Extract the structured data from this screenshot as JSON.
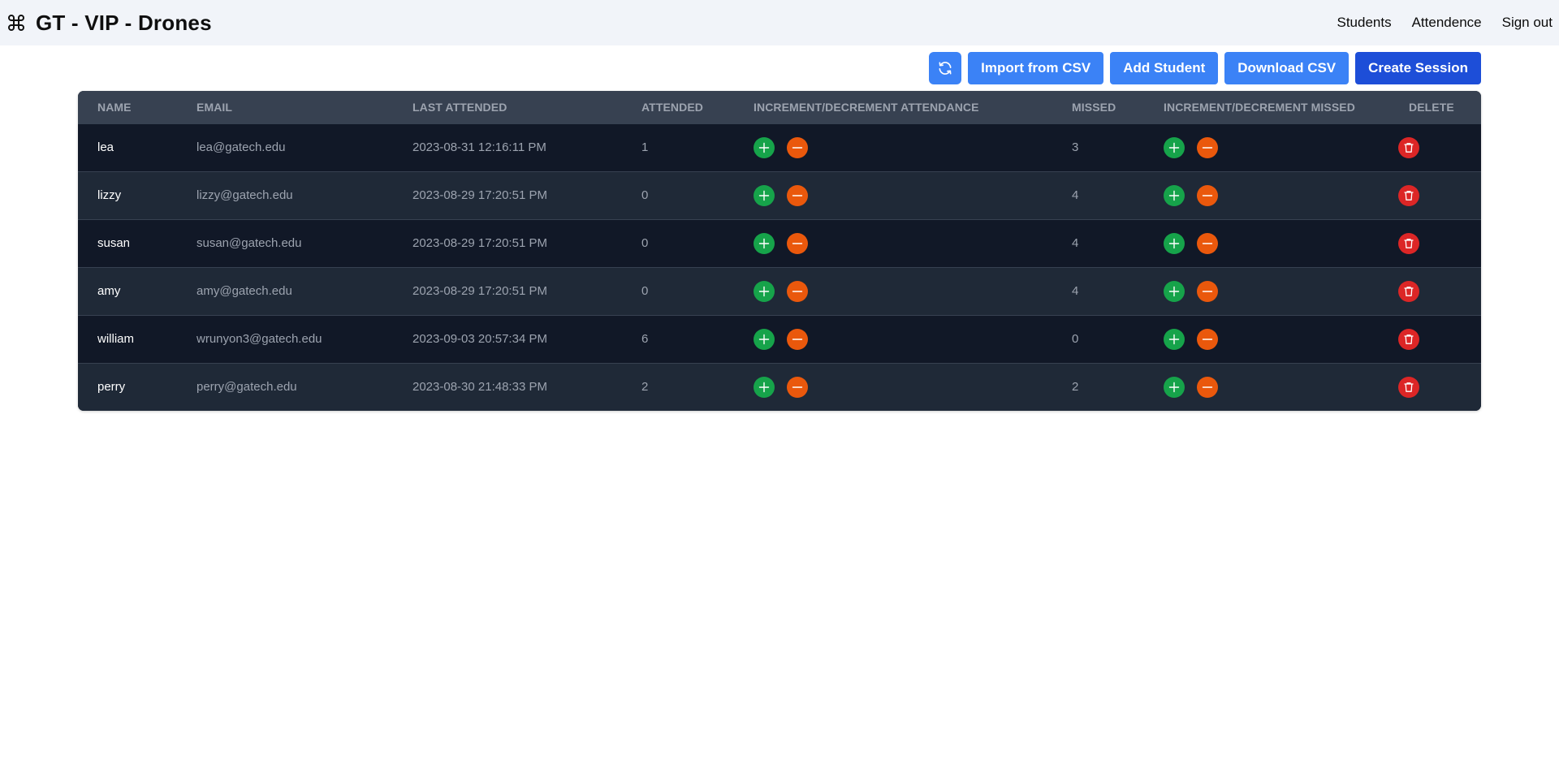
{
  "app": {
    "title": "GT - VIP - Drones",
    "logo_icon": "command-icon"
  },
  "nav": {
    "links": [
      "Students",
      "Attendence",
      "Sign out"
    ]
  },
  "toolbar": {
    "refresh_icon": "refresh-icon",
    "import_label": "Import from CSV",
    "add_label": "Add Student",
    "download_label": "Download CSV",
    "create_label": "Create Session"
  },
  "colors": {
    "nav_bg": "#f1f4f9",
    "button_blue": "#3b82f6",
    "button_primary": "#1d4ed8",
    "table_header": "#374151",
    "row_dark": "#111827",
    "row_light": "#1f2937",
    "increment": "#16a34a",
    "decrement": "#ea580c",
    "delete": "#dc2626"
  },
  "table": {
    "headers": [
      "Name",
      "Email",
      "Last Attended",
      "Attended",
      "Increment/Decrement Attendance",
      "Missed",
      "Increment/Decrement Missed",
      "Delete"
    ],
    "rows": [
      {
        "name": "lea",
        "email": "lea@gatech.edu",
        "last_attended": "2023-08-31 12:16:11 PM",
        "attended": "1",
        "missed": "3"
      },
      {
        "name": "lizzy",
        "email": "lizzy@gatech.edu",
        "last_attended": "2023-08-29 17:20:51 PM",
        "attended": "0",
        "missed": "4"
      },
      {
        "name": "susan",
        "email": "susan@gatech.edu",
        "last_attended": "2023-08-29 17:20:51 PM",
        "attended": "0",
        "missed": "4"
      },
      {
        "name": "amy",
        "email": "amy@gatech.edu",
        "last_attended": "2023-08-29 17:20:51 PM",
        "attended": "0",
        "missed": "4"
      },
      {
        "name": "william",
        "email": "wrunyon3@gatech.edu",
        "last_attended": "2023-09-03 20:57:34 PM",
        "attended": "6",
        "missed": "0"
      },
      {
        "name": "perry",
        "email": "perry@gatech.edu",
        "last_attended": "2023-08-30 21:48:33 PM",
        "attended": "2",
        "missed": "2"
      }
    ]
  }
}
